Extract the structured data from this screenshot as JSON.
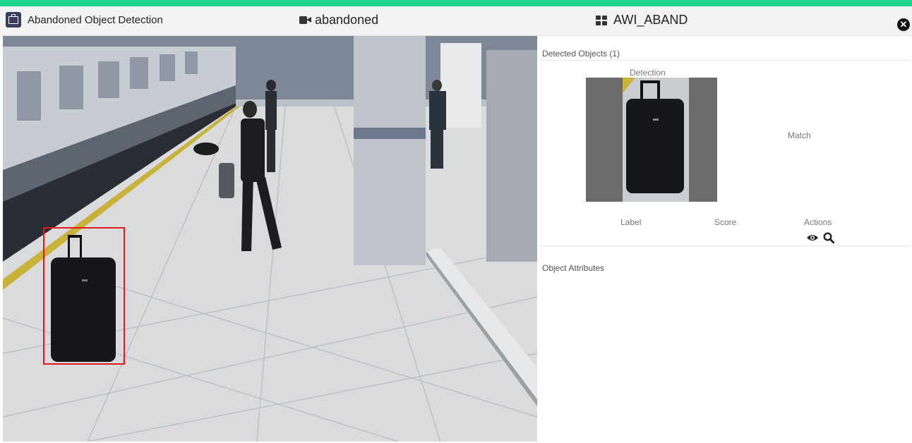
{
  "header": {
    "app_title": "Abandoned Object Detection",
    "camera_icon": "video-camera-icon",
    "camera_name": "abandoned",
    "group_icon": "grid-icon",
    "group_name": "AWI_ABAND",
    "close_icon": "close-circle-icon"
  },
  "colors": {
    "accent": "#1ed68d",
    "detection_box": "#e01b1b",
    "header_bg": "#f3f3f3"
  },
  "panel": {
    "detected_objects_title": "Detected Objects (1)",
    "columns": {
      "detection": "Detection",
      "match": "Match",
      "label": "Label",
      "score": "Score",
      "actions": "Actions"
    },
    "action_icons": [
      "eye-icon",
      "search-icon"
    ],
    "object_attributes_title": "Object Attributes"
  }
}
